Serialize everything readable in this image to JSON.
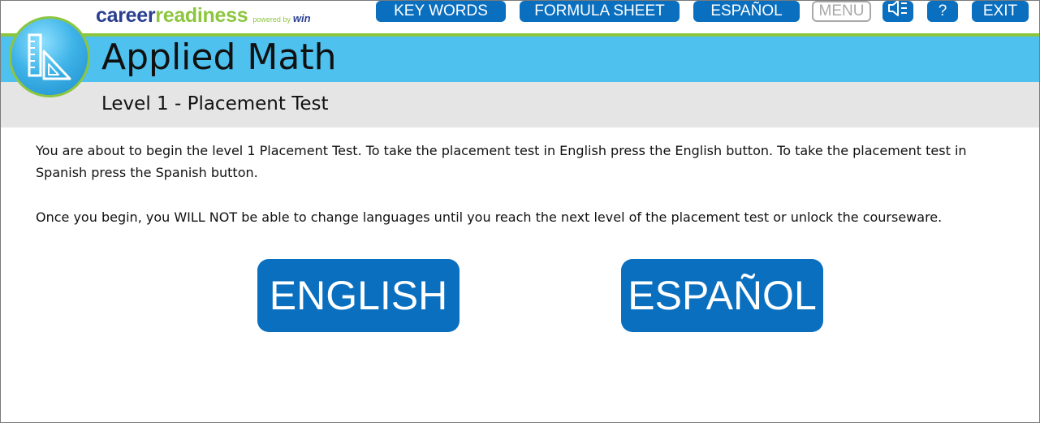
{
  "brand": {
    "career": "career",
    "readiness": "readiness",
    "powered_by": "powered by",
    "win": "win"
  },
  "topnav": {
    "key_words": "KEY WORDS",
    "formula_sheet": "FORMULA SHEET",
    "espanol": "ESPAÑOL",
    "menu": "MENU",
    "speaker_icon": "speaker-muted-icon",
    "help": "?",
    "exit": "EXIT"
  },
  "header": {
    "title": "Applied Math",
    "subtitle": "Level 1 - Placement Test",
    "logo_icon": "set-square-ruler-icon"
  },
  "content": {
    "paragraph1": "You are about to begin the level 1 Placement Test. To take the placement test in English press the English button. To take the placement test in Spanish press the Spanish button.",
    "paragraph2": "Once you begin, you WILL NOT be able to change languages until you reach the next level of the placement test or unlock the courseware."
  },
  "buttons": {
    "english": "ENGLISH",
    "espanol": "ESPAÑOL"
  },
  "colors": {
    "button_blue": "#0a6fbf",
    "header_blue": "#4ec1ee",
    "brand_navy": "#2a3f90",
    "brand_green": "#8cc63f",
    "sub_band_gray": "#e5e5e5",
    "disabled_gray": "#a8a8a8"
  }
}
